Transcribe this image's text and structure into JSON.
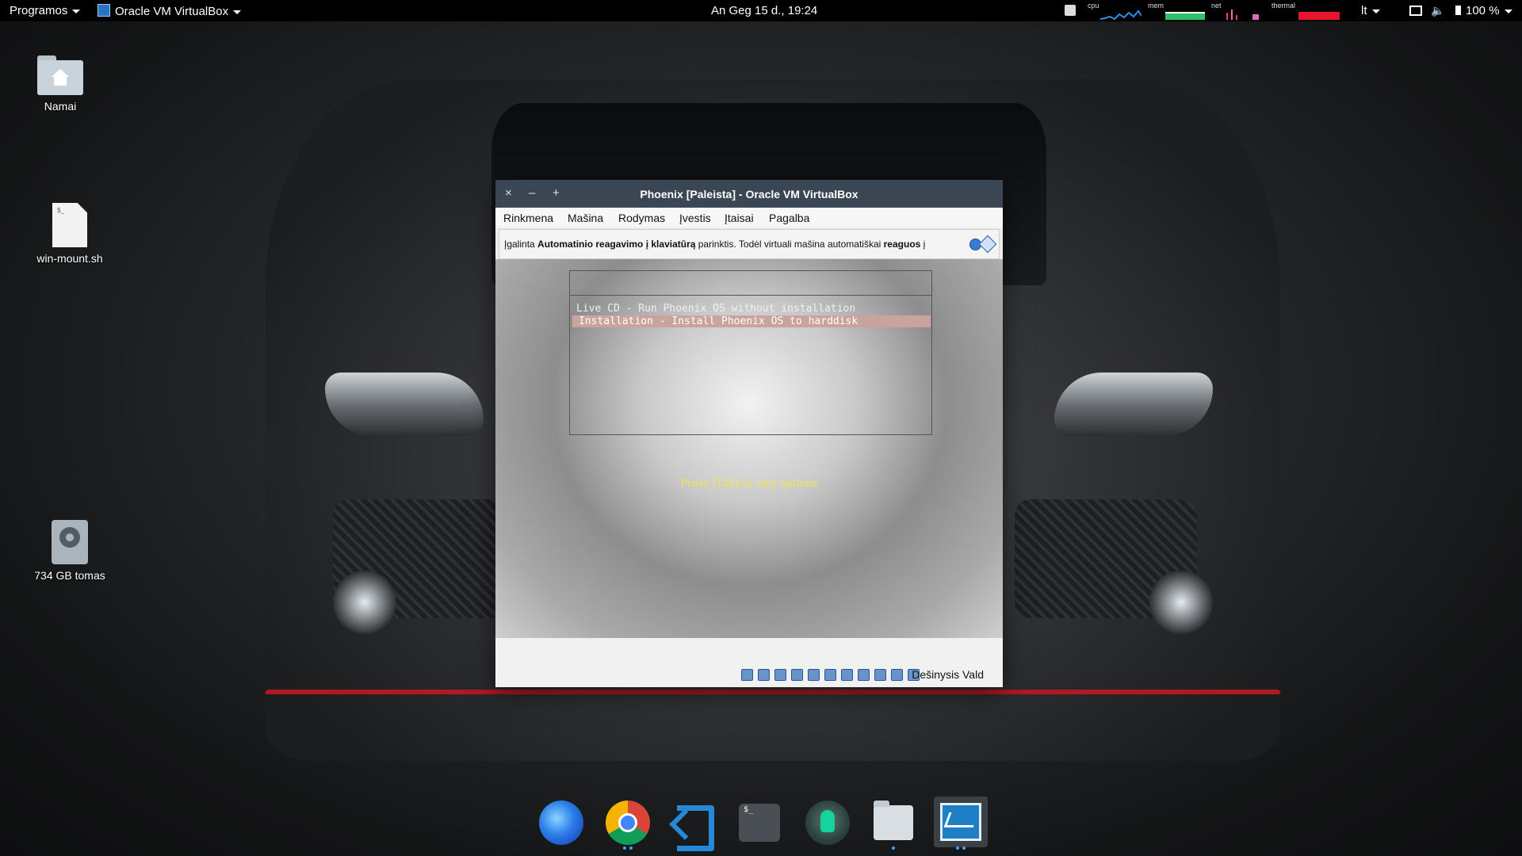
{
  "top_panel": {
    "apps_label": "Programos",
    "active_window": "Oracle VM VirtualBox",
    "clock": "An Geg 15 d., 19:24",
    "monitors": {
      "cpu": "cpu",
      "mem": "mem",
      "net": "net",
      "thermal": "thermal"
    },
    "keyboard_layout": "lt",
    "battery": "100 %"
  },
  "desktop_icons": [
    {
      "label": "Namai",
      "icon": "home-folder-icon"
    },
    {
      "label": "win-mount.sh",
      "icon": "script-file-icon"
    },
    {
      "label": "734 GB tomas",
      "icon": "drive-icon"
    }
  ],
  "vbox": {
    "title": "Phoenix [Paleista] - Oracle VM VirtualBox",
    "window_buttons": {
      "close": "×",
      "minimize": "–",
      "maximize": "+"
    },
    "menu": [
      "Rinkmena",
      "Mašina",
      "Rodymas",
      "Įvestis",
      "Įtaisai",
      "Pagalba"
    ],
    "notice": {
      "prefix": "Įgalinta ",
      "bold1": "Automatinio reagavimo į klaviatūrą",
      "middle": " parinktis. Todėl virtuali mašina automatiškai ",
      "bold2": "reaguos",
      "suffix": " į"
    },
    "boot_menu": {
      "items": [
        "Live CD - Run Phoenix OS without installation",
        "Installation - Install Phoenix OS to harddisk"
      ],
      "selected_index": 1,
      "hint": "Press [Tab] to edit options"
    },
    "status": {
      "host_key": "Dešinysis Vald"
    }
  },
  "dock": [
    "firefox-icon",
    "chrome-icon",
    "vscode-icon",
    "terminal-icon",
    "gitkraken-icon",
    "files-icon",
    "system-monitor-icon"
  ],
  "colors": {
    "title_bar": "#3a4653",
    "selection": "#c9a39c",
    "hint": "#f3e64a",
    "accent": "#3ea6ff"
  }
}
